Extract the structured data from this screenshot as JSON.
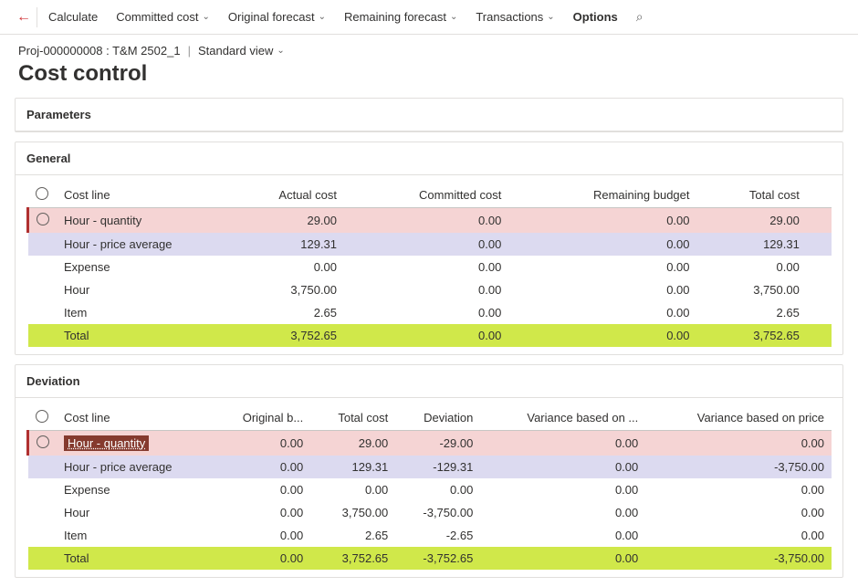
{
  "toolbar": {
    "calculate": "Calculate",
    "committed_cost": "Committed cost",
    "original_forecast": "Original forecast",
    "remaining_forecast": "Remaining forecast",
    "transactions": "Transactions",
    "options": "Options"
  },
  "breadcrumb": {
    "project": "Proj-000000008 : T&M 2502_1",
    "view": "Standard view"
  },
  "page_title": "Cost control",
  "parameters_label": "Parameters",
  "general": {
    "title": "General",
    "columns": [
      "Cost line",
      "Actual cost",
      "Committed cost",
      "Remaining budget",
      "Total cost"
    ],
    "rows": [
      {
        "label": "Hour - quantity",
        "actual": "29.00",
        "committed": "0.00",
        "remaining": "0.00",
        "total": "29.00",
        "style": "pink",
        "radio": true,
        "mark": true
      },
      {
        "label": "Hour - price average",
        "actual": "129.31",
        "committed": "0.00",
        "remaining": "0.00",
        "total": "129.31",
        "style": "lavender"
      },
      {
        "label": "Expense",
        "actual": "0.00",
        "committed": "0.00",
        "remaining": "0.00",
        "total": "0.00"
      },
      {
        "label": "Hour",
        "actual": "3,750.00",
        "committed": "0.00",
        "remaining": "0.00",
        "total": "3,750.00"
      },
      {
        "label": "Item",
        "actual": "2.65",
        "committed": "0.00",
        "remaining": "0.00",
        "total": "2.65"
      },
      {
        "label": "Total",
        "actual": "3,752.65",
        "committed": "0.00",
        "remaining": "0.00",
        "total": "3,752.65",
        "style": "lime"
      }
    ]
  },
  "deviation": {
    "title": "Deviation",
    "columns": [
      "Cost line",
      "Original b...",
      "Total cost",
      "Deviation",
      "Variance based on ...",
      "Variance based on price"
    ],
    "rows": [
      {
        "label": "Hour - quantity",
        "orig": "0.00",
        "total": "29.00",
        "dev": "-29.00",
        "var1": "0.00",
        "var2": "0.00",
        "style": "pink",
        "radio": true,
        "mark": true,
        "selected": true
      },
      {
        "label": "Hour - price average",
        "orig": "0.00",
        "total": "129.31",
        "dev": "-129.31",
        "var1": "0.00",
        "var2": "-3,750.00",
        "style": "lavender"
      },
      {
        "label": "Expense",
        "orig": "0.00",
        "total": "0.00",
        "dev": "0.00",
        "var1": "0.00",
        "var2": "0.00"
      },
      {
        "label": "Hour",
        "orig": "0.00",
        "total": "3,750.00",
        "dev": "-3,750.00",
        "var1": "0.00",
        "var2": "0.00"
      },
      {
        "label": "Item",
        "orig": "0.00",
        "total": "2.65",
        "dev": "-2.65",
        "var1": "0.00",
        "var2": "0.00"
      },
      {
        "label": "Total",
        "orig": "0.00",
        "total": "3,752.65",
        "dev": "-3,752.65",
        "var1": "0.00",
        "var2": "-3,750.00",
        "style": "lime"
      }
    ]
  }
}
